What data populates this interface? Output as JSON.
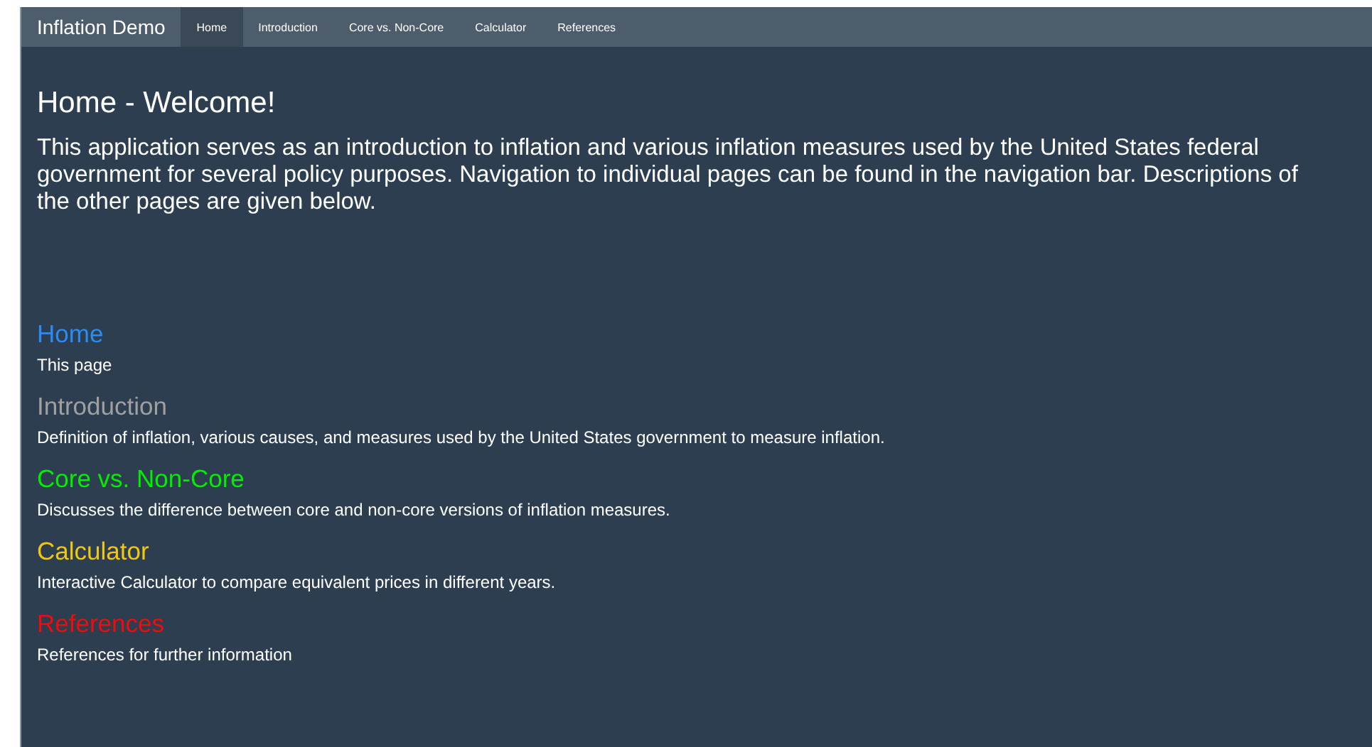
{
  "navbar": {
    "brand": "Inflation Demo",
    "tabs": [
      {
        "label": "Home",
        "selected": true
      },
      {
        "label": "Introduction",
        "selected": false
      },
      {
        "label": "Core vs. Non-Core",
        "selected": false
      },
      {
        "label": "Calculator",
        "selected": false
      },
      {
        "label": "References",
        "selected": false
      }
    ]
  },
  "title": "Home - Welcome!",
  "intro": "This application serves as an introduction to inflation and various inflation measures used by the United States federal government for several policy purposes. Navigation to individual pages can be found in the navigation bar. Descriptions of the other pages are given below.",
  "sections": [
    {
      "heading": "Home",
      "color": "#2a8cf0",
      "description": "This page"
    },
    {
      "heading": "Introduction",
      "color": "#a0a0a0",
      "description": "Definition of inflation, various causes, and measures used by the United States government to measure inflation."
    },
    {
      "heading": "Core vs. Non-Core",
      "color": "#00ee00",
      "description": "Discusses the difference between core and non-core versions of inflation measures."
    },
    {
      "heading": "Calculator",
      "color": "#f2c80f",
      "description": "Interactive Calculator to compare equivalent prices in different years."
    },
    {
      "heading": "References",
      "color": "#f00c0c",
      "description": "References for further information"
    }
  ]
}
